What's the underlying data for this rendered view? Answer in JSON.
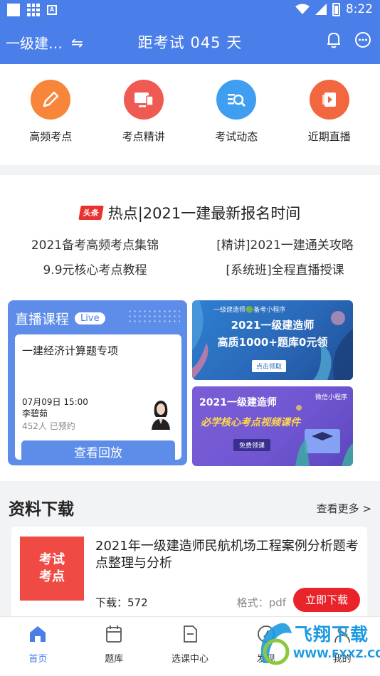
{
  "status_bar": {
    "time": "8:22"
  },
  "header": {
    "exam_select": "一级建…",
    "switch_icon": "⇋",
    "countdown": "距考试 045 天"
  },
  "quick_entries": [
    {
      "label": "高频考点",
      "color": "#f7853a",
      "icon": "pencil-icon"
    },
    {
      "label": "考点精讲",
      "color": "#ef5a52",
      "icon": "monitor-icon"
    },
    {
      "label": "考试动态",
      "color": "#3f9ef0",
      "icon": "search-list-icon"
    },
    {
      "label": "近期直播",
      "color": "#f2673f",
      "icon": "video-icon"
    }
  ],
  "headline": {
    "badge": "头条",
    "title": "热点|2021一建最新报名时间"
  },
  "links": [
    "2021备考高频考点集锦",
    "[精讲]2021一建通关攻略",
    "9.9元核心考点教程",
    "[系统班]全程直播授课"
  ],
  "live": {
    "title": "直播课程",
    "tag": "Live",
    "course": "一建经济计算题专项",
    "datetime": "07月09日 15:00",
    "teacher": "李碧茹",
    "booked": "452人 已预约",
    "button": "查看回放"
  },
  "banner1": {
    "top": "一级建造师🟢备考小程序",
    "line1": "2021一级建造师",
    "line2": "高质1000+题库0元领",
    "button": "点击领取"
  },
  "banner2": {
    "mini": "微信小程序",
    "line1": "2021一级建造师",
    "line2": "必学核心考点视频课件",
    "button": "免费领课"
  },
  "downloads": {
    "title": "资料下载",
    "more": "查看更多 >",
    "item": {
      "cover_line1": "考试",
      "cover_line2": "考点",
      "name": "2021年一级建造师民航机场工程案例分析题考点整理与分析",
      "count": "下载：572",
      "format": "格式：pdf",
      "button": "立即下载"
    }
  },
  "bottom_nav": [
    {
      "label": "首页",
      "active": true
    },
    {
      "label": "题库",
      "active": false
    },
    {
      "label": "选课中心",
      "active": false
    },
    {
      "label": "发现",
      "active": false
    },
    {
      "label": "我的",
      "active": false
    }
  ],
  "watermark": {
    "text": "飞翔下载",
    "url": "WWW.FXXZ.COM"
  }
}
